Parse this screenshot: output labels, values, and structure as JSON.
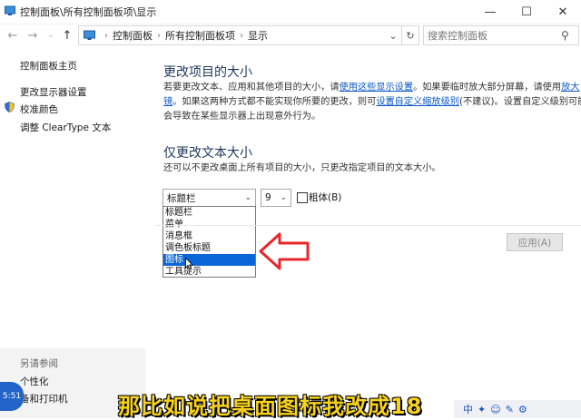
{
  "window": {
    "title": "控制面板\\所有控制面板项\\显示",
    "minimize": "—",
    "maximize": "☐",
    "close": "✕"
  },
  "nav": {
    "back": "←",
    "forward": "→",
    "up": "↑",
    "breadcrumbs": [
      "控制面板",
      "所有控制面板项",
      "显示"
    ],
    "dropdown": "⌄",
    "refresh": "↻",
    "search_placeholder": "搜索控制面板",
    "search_icon": "⚲"
  },
  "sidebar": {
    "home": "控制面板主页",
    "items": [
      "更改显示器设置",
      "校准颜色",
      "调整 ClearType 文本"
    ],
    "see_also": "另请参阅",
    "see_also_items": [
      "个性化",
      "备和打印机"
    ]
  },
  "main": {
    "section1_title": "更改项目的大小",
    "section1_p1": "若要更改文本、应用和其他项目的大小，请",
    "section1_link1": "使用这些显示设置",
    "section1_p2": "。如果要临时放大部分屏幕，请使用",
    "section1_link2a": "放大",
    "section1_link2b": "镜",
    "section1_p3": "。如果这两种方式都不能实现你所要的更改，则可",
    "section1_link3": "设置自定义缩放级别",
    "section1_p4": "(不建议)。设置自定义级别可能",
    "section1_p5": "会导致在某些显示器上出现意外行为。",
    "section2_title": "仅更改文本大小",
    "section2_desc": "还可以不更改桌面上所有项目的大小，只更改指定项目的文本大小。",
    "item_select_value": "标题栏",
    "item_options": [
      "标题栏",
      "菜单",
      "消息框",
      "调色板标题",
      "图标",
      "工具提示"
    ],
    "selected_index": 4,
    "size_select_value": "9",
    "bold_label": "粗体(B)",
    "bold_checked": false,
    "apply_label": "应用(A)"
  },
  "overlay": {
    "caption": "那比如说把桌面图标我改成18",
    "clock": "5:51",
    "taskbar_text": "中"
  },
  "colors": {
    "accent_link": "#0a58c8",
    "heading": "#1e395b",
    "selection": "#0a66d8",
    "annotation_arrow": "#e8272b",
    "caption": "#f7d21c"
  }
}
